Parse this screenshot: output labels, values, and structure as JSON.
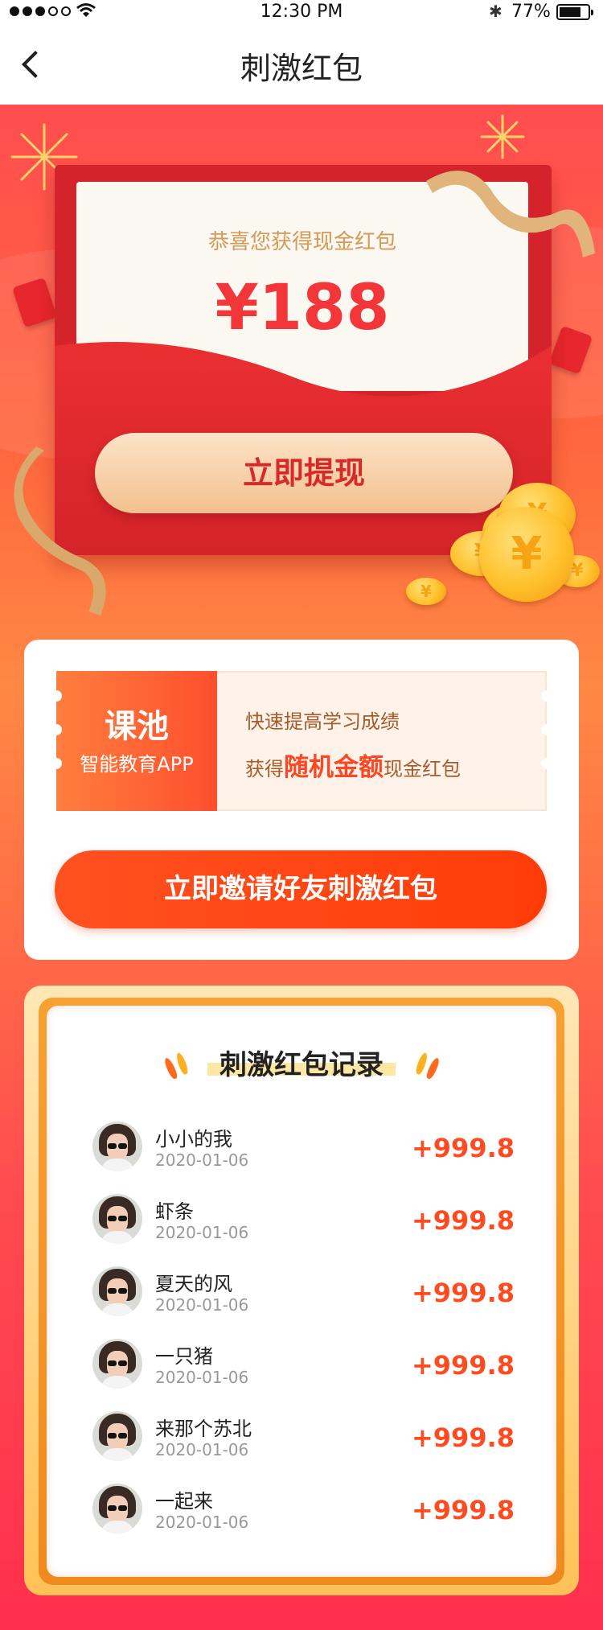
{
  "status_bar": {
    "time": "12:30 PM",
    "battery": "77%",
    "battery_level": 0.77
  },
  "nav": {
    "title": "刺激红包",
    "back_icon": "chevron-left-icon"
  },
  "envelope": {
    "congrats": "恭喜您获得现金红包",
    "amount": "¥188",
    "withdraw_label": "立即提现"
  },
  "promo": {
    "brand": "课池",
    "brand_sub": "智能教育APP",
    "line1": "快速提高学习成绩",
    "line2_prefix": "获得",
    "line2_highlight": "随机金额",
    "line2_suffix": "现金红包",
    "invite_label": "立即邀请好友刺激红包"
  },
  "records": {
    "title": "刺激红包记录",
    "items": [
      {
        "name": "小小的我",
        "date": "2020-01-06",
        "amount": "+999.8"
      },
      {
        "name": "虾条",
        "date": "2020-01-06",
        "amount": "+999.8"
      },
      {
        "name": "夏天的风",
        "date": "2020-01-06",
        "amount": "+999.8"
      },
      {
        "name": "一只猪",
        "date": "2020-01-06",
        "amount": "+999.8"
      },
      {
        "name": "来那个苏北",
        "date": "2020-01-06",
        "amount": "+999.8"
      },
      {
        "name": "一起来",
        "date": "2020-01-06",
        "amount": "+999.8"
      }
    ]
  },
  "colors": {
    "accent": "#ff4b1f",
    "envelope_red": "#d4232a",
    "gold": "#f2c08d"
  }
}
